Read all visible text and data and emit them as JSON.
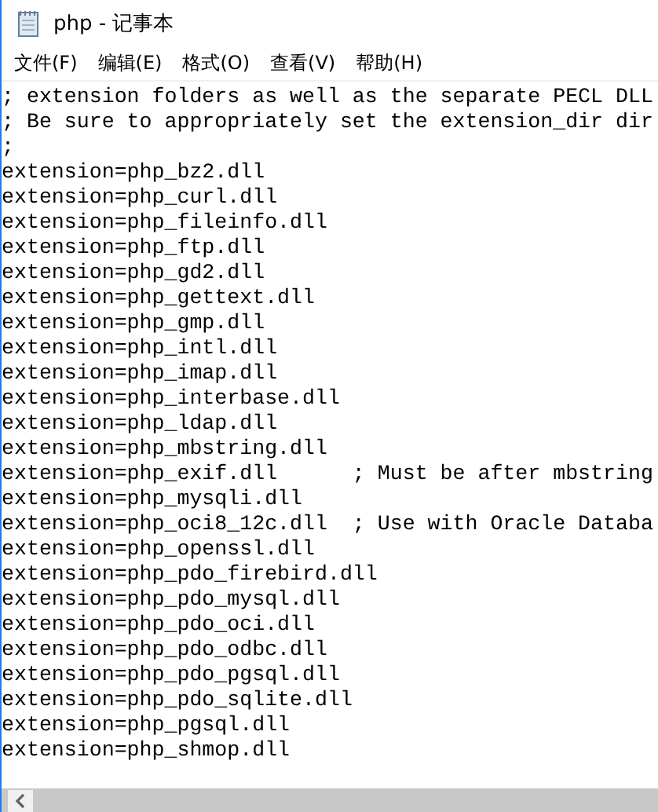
{
  "window": {
    "title": "php - 记事本"
  },
  "menu": [
    "文件(F)",
    "编辑(E)",
    "格式(O)",
    "查看(V)",
    "帮助(H)"
  ],
  "lines": [
    "; extension folders as well as the separate PECL DLL",
    "; Be sure to appropriately set the extension_dir dir",
    ";",
    "extension=php_bz2.dll",
    "extension=php_curl.dll",
    "extension=php_fileinfo.dll",
    "extension=php_ftp.dll",
    "extension=php_gd2.dll",
    "extension=php_gettext.dll",
    "extension=php_gmp.dll",
    "extension=php_intl.dll",
    "extension=php_imap.dll",
    "extension=php_interbase.dll",
    "extension=php_ldap.dll",
    "extension=php_mbstring.dll",
    "extension=php_exif.dll      ; Must be after mbstring",
    "extension=php_mysqli.dll",
    "extension=php_oci8_12c.dll  ; Use with Oracle Databa",
    "extension=php_openssl.dll",
    "extension=php_pdo_firebird.dll",
    "extension=php_pdo_mysql.dll",
    "extension=php_pdo_oci.dll",
    "extension=php_pdo_odbc.dll",
    "extension=php_pdo_pgsql.dll",
    "extension=php_pdo_sqlite.dll",
    "extension=php_pgsql.dll",
    "extension=php_shmop.dll"
  ]
}
